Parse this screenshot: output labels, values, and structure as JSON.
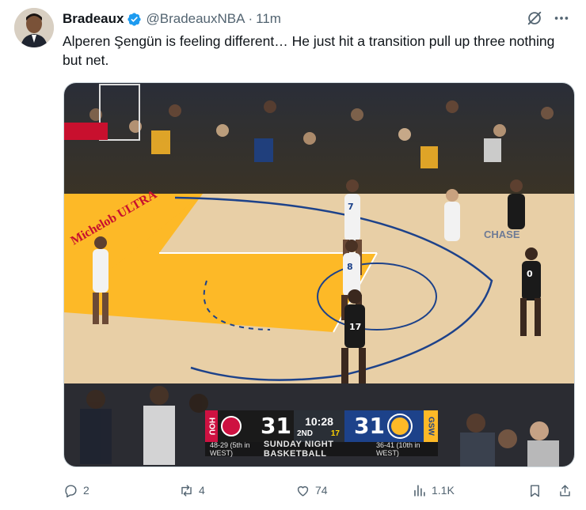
{
  "tweet": {
    "display_name": "Bradeaux",
    "handle": "@BradeauxNBA",
    "separator": "·",
    "time": "11m",
    "text": "Alperen Şengün is feeling different… He just hit a transition pull up three nothing but net."
  },
  "media": {
    "scorebug": {
      "home_abbr": "HOU",
      "home_score": "31",
      "clock": "10:28",
      "period": "2ND",
      "shot_clock": "17",
      "away_score": "31",
      "away_abbr": "GSW",
      "home_record": "48-29 (5th in WEST)",
      "banner": "SUNDAY NIGHT BASKETBALL",
      "away_record": "36-41 (10th in WEST)"
    },
    "court_sign": "Michelob ULTRA",
    "baseline_sign": "CHASE",
    "jerseys": [
      "7",
      "8",
      "17",
      "0"
    ]
  },
  "actions": {
    "reply_count": "2",
    "retweet_count": "4",
    "like_count": "74",
    "view_count": "1.1K"
  },
  "colors": {
    "text": "#0f1419",
    "secondary": "#536471",
    "verified": "#1d9bf0",
    "rockets_red": "#ce1141",
    "warriors_blue": "#1d428a",
    "warriors_gold": "#fdb927"
  }
}
